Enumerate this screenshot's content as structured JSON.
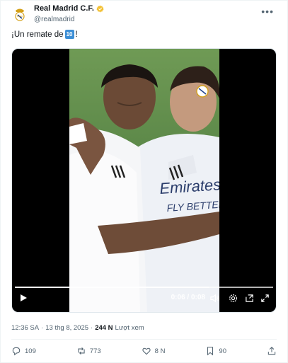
{
  "author": {
    "name": "Real Madrid C.F.",
    "handle": "@realmadrid"
  },
  "icons": {
    "avatar": "real-madrid-crest",
    "verified": "gold-verified-badge",
    "more": "more-horizontal-icon"
  },
  "post": {
    "text_before": "¡Un remate de ",
    "emoji": "🔟",
    "text_after": "!"
  },
  "video": {
    "time": "0:06 / 0:08",
    "progress": 0.75,
    "jersey_text": "Emirates FLY BETTER"
  },
  "meta": {
    "time": "12:36 SA",
    "separator": "·",
    "date": "13 thg 8, 2025",
    "views_count": "244 N",
    "views_label": "Lượt xem"
  },
  "actions": {
    "replies": "109",
    "reposts": "773",
    "likes": "8 N",
    "bookmarks": "90"
  },
  "colors": {
    "verified": "#f3c032",
    "text_secondary": "#536471",
    "keycap": "#3d8fd6"
  }
}
